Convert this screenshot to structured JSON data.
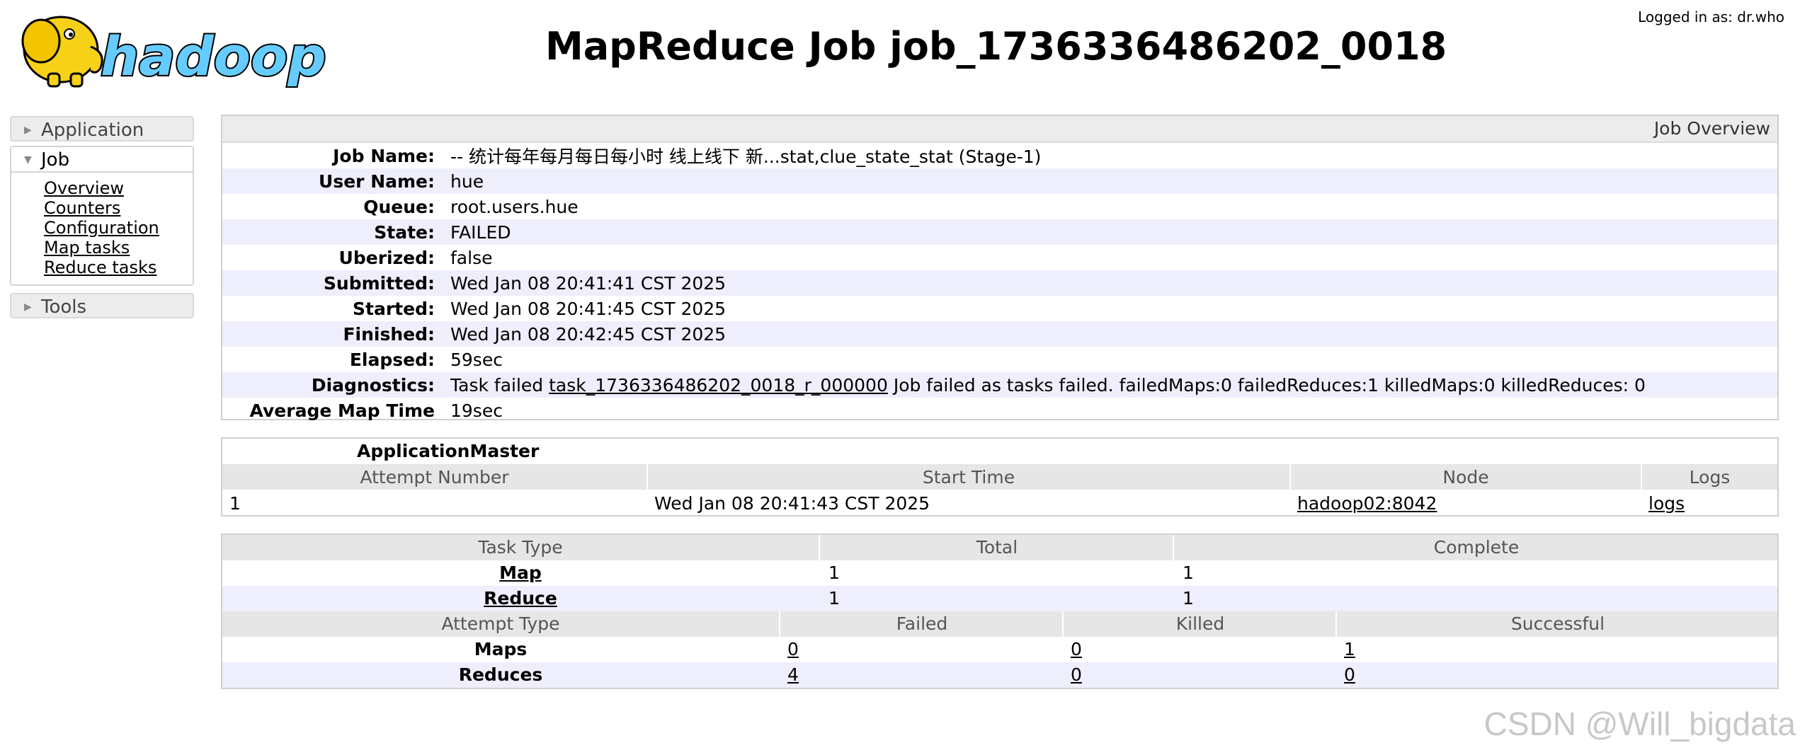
{
  "header": {
    "logo_text": "hadoop",
    "title": "MapReduce Job job_1736336486202_0018",
    "logged_in": "Logged in as: dr.who"
  },
  "sidebar": {
    "application": "Application",
    "job": "Job",
    "job_links": [
      "Overview",
      "Counters",
      "Configuration",
      "Map tasks",
      "Reduce tasks"
    ],
    "tools": "Tools"
  },
  "overview": {
    "heading": "Job Overview",
    "rows": [
      {
        "label": "Job Name:",
        "value": "-- 统计每年每月每日每小时 线上线下 新...stat,clue_state_stat (Stage-1)"
      },
      {
        "label": "User Name:",
        "value": "hue"
      },
      {
        "label": "Queue:",
        "value": "root.users.hue"
      },
      {
        "label": "State:",
        "value": "FAILED"
      },
      {
        "label": "Uberized:",
        "value": "false"
      },
      {
        "label": "Submitted:",
        "value": "Wed Jan 08 20:41:41 CST 2025"
      },
      {
        "label": "Started:",
        "value": "Wed Jan 08 20:41:45 CST 2025"
      },
      {
        "label": "Finished:",
        "value": "Wed Jan 08 20:42:45 CST 2025"
      },
      {
        "label": "Elapsed:",
        "value": "59sec"
      },
      {
        "label": "Diagnostics:",
        "value": ""
      },
      {
        "label": "Average Map Time",
        "value": "19sec"
      }
    ],
    "diagnostics": {
      "prefix": "Task failed ",
      "task_link": "task_1736336486202_0018_r_000000",
      "suffix": " Job failed as tasks failed. failedMaps:0 failedReduces:1 killedMaps:0 killedReduces: 0"
    }
  },
  "application_master": {
    "title": "ApplicationMaster",
    "columns": [
      "Attempt Number",
      "Start Time",
      "Node",
      "Logs"
    ],
    "row": {
      "attempt": "1",
      "start_time": "Wed Jan 08 20:41:43 CST 2025",
      "node": "hadoop02:8042",
      "logs": "logs"
    }
  },
  "tasks": {
    "columns": [
      "Task Type",
      "Total",
      "Complete"
    ],
    "rows": [
      {
        "type": "Map",
        "total": "1",
        "complete": "1"
      },
      {
        "type": "Reduce",
        "total": "1",
        "complete": "1"
      }
    ],
    "attempt_columns": [
      "Attempt Type",
      "Failed",
      "Killed",
      "Successful"
    ],
    "attempt_rows": [
      {
        "type": "Maps",
        "failed": "0",
        "killed": "0",
        "successful": "1"
      },
      {
        "type": "Reduces",
        "failed": "4",
        "killed": "0",
        "successful": "0"
      }
    ]
  },
  "watermark": "CSDN @Will_bigdata",
  "colors": {
    "row_alt": "#eeeefc",
    "header_bg": "#e6e6e6",
    "logo_yellow": "#f7d117",
    "logo_blue": "#66ccff"
  }
}
